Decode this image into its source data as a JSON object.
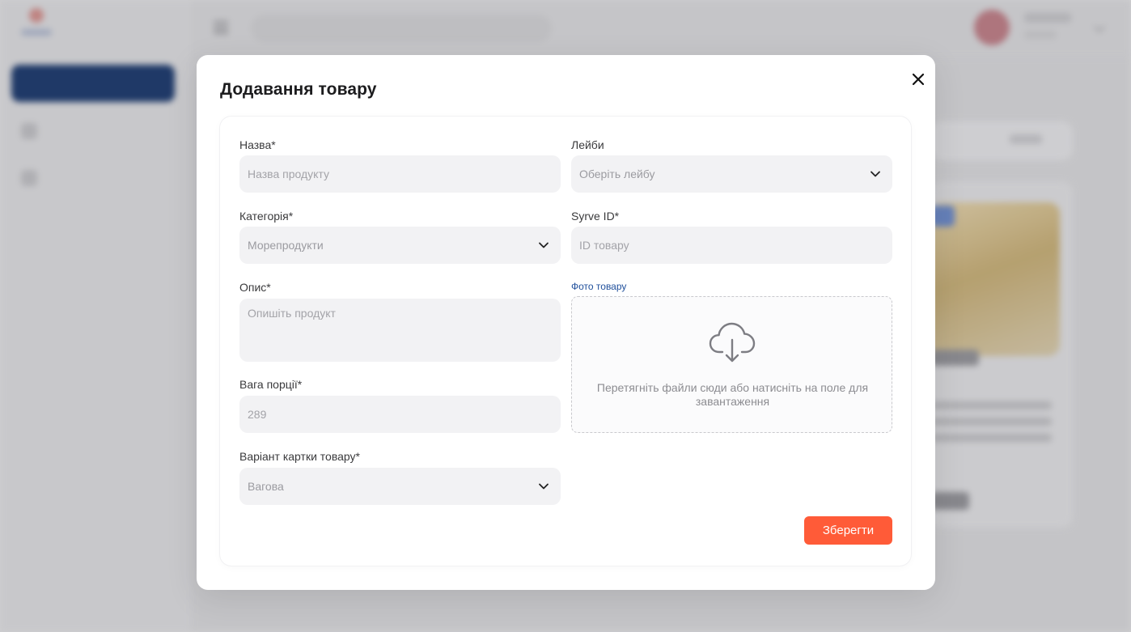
{
  "modal": {
    "title": "Додавання товару",
    "save_label": "Зберегти"
  },
  "form": {
    "name": {
      "label": "Назва*",
      "placeholder": "Назва продукту"
    },
    "labels": {
      "label": "Лейби",
      "value": "Оберіть лейбу"
    },
    "category": {
      "label": "Категорія*",
      "value": "Морепродукти"
    },
    "syrve_id": {
      "label": "Syrve ID*",
      "placeholder": "ID товару"
    },
    "description": {
      "label": "Опис*",
      "placeholder": "Опишіть продукт"
    },
    "photo": {
      "label": "Фото товару",
      "hint": "Перетягніть файли сюди або натисніть на поле для завантаження"
    },
    "weight": {
      "label": "Вага порції*",
      "placeholder": "289"
    },
    "card_variant": {
      "label": "Варіант картки товару*",
      "value": "Вагова"
    }
  },
  "colors": {
    "accent_save": "#ff5b38",
    "link": "#1f4f9b",
    "input_bg": "#f2f2f4",
    "sidebar_active": "#1f3b6b"
  },
  "icons": [
    "close-icon",
    "chevron-down-icon",
    "cloud-download-icon",
    "menu-icon"
  ]
}
